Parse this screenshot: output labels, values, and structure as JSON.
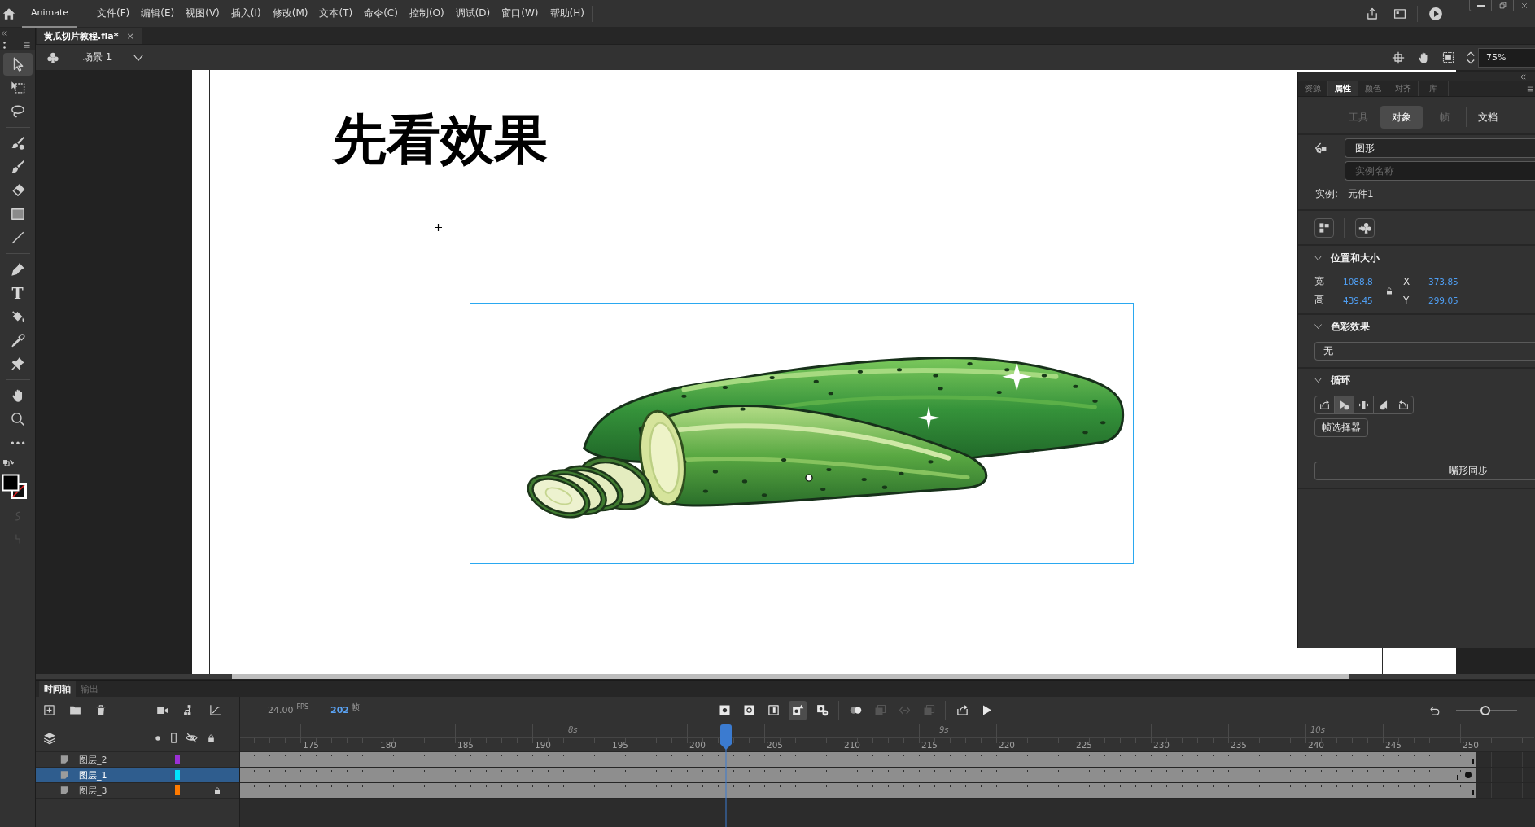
{
  "menu_bar": {
    "app_tab": {
      "label": "Animate",
      "selected": true
    },
    "menus": [
      "文件(F)",
      "编辑(E)",
      "视图(V)",
      "插入(I)",
      "修改(M)",
      "文本(T)",
      "命令(C)",
      "控制(O)",
      "调试(D)",
      "窗口(W)",
      "帮助(H)"
    ]
  },
  "document_tabs": [
    {
      "title": "黄瓜切片教程.fla*",
      "close": "×",
      "selected": true
    }
  ],
  "scene_bar": {
    "scene": "场景 1",
    "zoom": "75%"
  },
  "tool_groups": [
    {
      "tools": [
        {
          "kind": "selection",
          "selected": true
        },
        {
          "kind": "free-transform",
          "selected": false
        },
        {
          "kind": "lasso",
          "selected": false
        }
      ]
    },
    {
      "tools": [
        {
          "kind": "fluid-brush",
          "selected": false
        },
        {
          "kind": "brush",
          "selected": false
        },
        {
          "kind": "eraser",
          "selected": false
        },
        {
          "kind": "rectangle",
          "selected": false
        },
        {
          "kind": "line",
          "selected": false
        }
      ]
    },
    {
      "tools": [
        {
          "kind": "pen",
          "selected": false
        },
        {
          "kind": "text",
          "glyph": "T",
          "selected": false
        },
        {
          "kind": "paint-bucket",
          "selected": false
        },
        {
          "kind": "eyedropper",
          "selected": false
        },
        {
          "kind": "pin",
          "selected": false
        }
      ]
    },
    {
      "tools": [
        {
          "kind": "hand",
          "selected": false
        },
        {
          "kind": "zoom",
          "selected": false
        },
        {
          "kind": "more",
          "selected": false
        }
      ]
    }
  ],
  "tool_options": [
    {
      "kind": "smooth",
      "disabled": true
    },
    {
      "kind": "straighten",
      "disabled": true
    }
  ],
  "stage": {
    "heading": "先看效果",
    "instance": {
      "selected": true
    }
  },
  "properties": {
    "panel_tabs": [
      {
        "label": "资源",
        "selected": false
      },
      {
        "label": "属性",
        "selected": true
      },
      {
        "label": "颜色",
        "selected": false
      },
      {
        "label": "对齐",
        "selected": false
      },
      {
        "label": "库",
        "selected": false
      }
    ],
    "sub_tabs": [
      {
        "label": "工具",
        "selected": false,
        "disabled": true
      },
      {
        "label": "对象",
        "selected": true,
        "disabled": false
      },
      {
        "label": "帧",
        "selected": false,
        "disabled": true
      },
      {
        "label": "文档",
        "selected": false,
        "disabled": false
      }
    ],
    "symbol_type": "图形",
    "instance_name": {
      "placeholder": "实例名称"
    },
    "instance_label": "实例:",
    "instance_of": "元件1",
    "position_size": {
      "title": "位置和大小",
      "expanded": true,
      "width": {
        "label": "宽",
        "value": "1088.8"
      },
      "height": {
        "label": "高",
        "value": "439.45"
      },
      "x": {
        "label": "X",
        "value": "373.85"
      },
      "y": {
        "label": "Y",
        "value": "299.05"
      },
      "locked": false
    },
    "color_effect": {
      "title": "色彩效果",
      "expanded": true,
      "value": "无"
    },
    "looping": {
      "title": "循环",
      "expanded": true,
      "modes": [
        {
          "kind": "loop",
          "selected": false
        },
        {
          "kind": "play-once",
          "selected": true
        },
        {
          "kind": "single-frame",
          "selected": false
        },
        {
          "kind": "play-once-reverse",
          "selected": false
        },
        {
          "kind": "loop-reverse",
          "selected": false
        }
      ],
      "frame_picker": "帧选择器",
      "lip_sync": "嘴形同步"
    }
  },
  "timeline": {
    "tabs": [
      {
        "label": "时间轴",
        "selected": true
      },
      {
        "label": "输出",
        "selected": false
      }
    ],
    "fps": "24.00",
    "fps_unit": "FPS",
    "current_frame": "202",
    "frame_unit": "帧",
    "frame_tool_groups": [
      {
        "tools": [
          {
            "kind": "insert-keyframe",
            "selected": false,
            "disabled": false
          },
          {
            "kind": "blank-keyframe",
            "selected": false,
            "disabled": false
          },
          {
            "kind": "insert-frame",
            "selected": false,
            "disabled": false
          },
          {
            "kind": "auto-keyframe",
            "selected": true,
            "disabled": false
          },
          {
            "kind": "remove-frame",
            "selected": false,
            "disabled": false
          }
        ]
      },
      {
        "tools": [
          {
            "kind": "onion-skin",
            "selected": false,
            "disabled": false
          },
          {
            "kind": "edit-multiple",
            "selected": false,
            "disabled": true
          },
          {
            "kind": "onion-markers",
            "selected": false,
            "disabled": true
          },
          {
            "kind": "copy-frames",
            "selected": false,
            "disabled": true
          }
        ]
      },
      {
        "tools": [
          {
            "kind": "loop",
            "selected": false,
            "disabled": false
          },
          {
            "kind": "play",
            "selected": false,
            "disabled": false
          }
        ]
      }
    ],
    "zoom_slider": {
      "level": 0.48
    },
    "frame_labels": [
      "175",
      "180",
      "185",
      "190",
      "195",
      "200",
      "205",
      "210",
      "215",
      "220",
      "225",
      "230",
      "235",
      "240",
      "245",
      "250"
    ],
    "second_labels": [
      "8s",
      "9s",
      "10s"
    ],
    "layers": [
      {
        "name": "图层_2",
        "color": "#9b30d6",
        "selected": false,
        "locked": false,
        "end_keyframe": false
      },
      {
        "name": "图层_1",
        "color": "#00e5ff",
        "selected": true,
        "locked": false,
        "end_keyframe": true
      },
      {
        "name": "图层_3",
        "color": "#ff7a00",
        "selected": false,
        "locked": true,
        "end_keyframe": false
      }
    ]
  }
}
